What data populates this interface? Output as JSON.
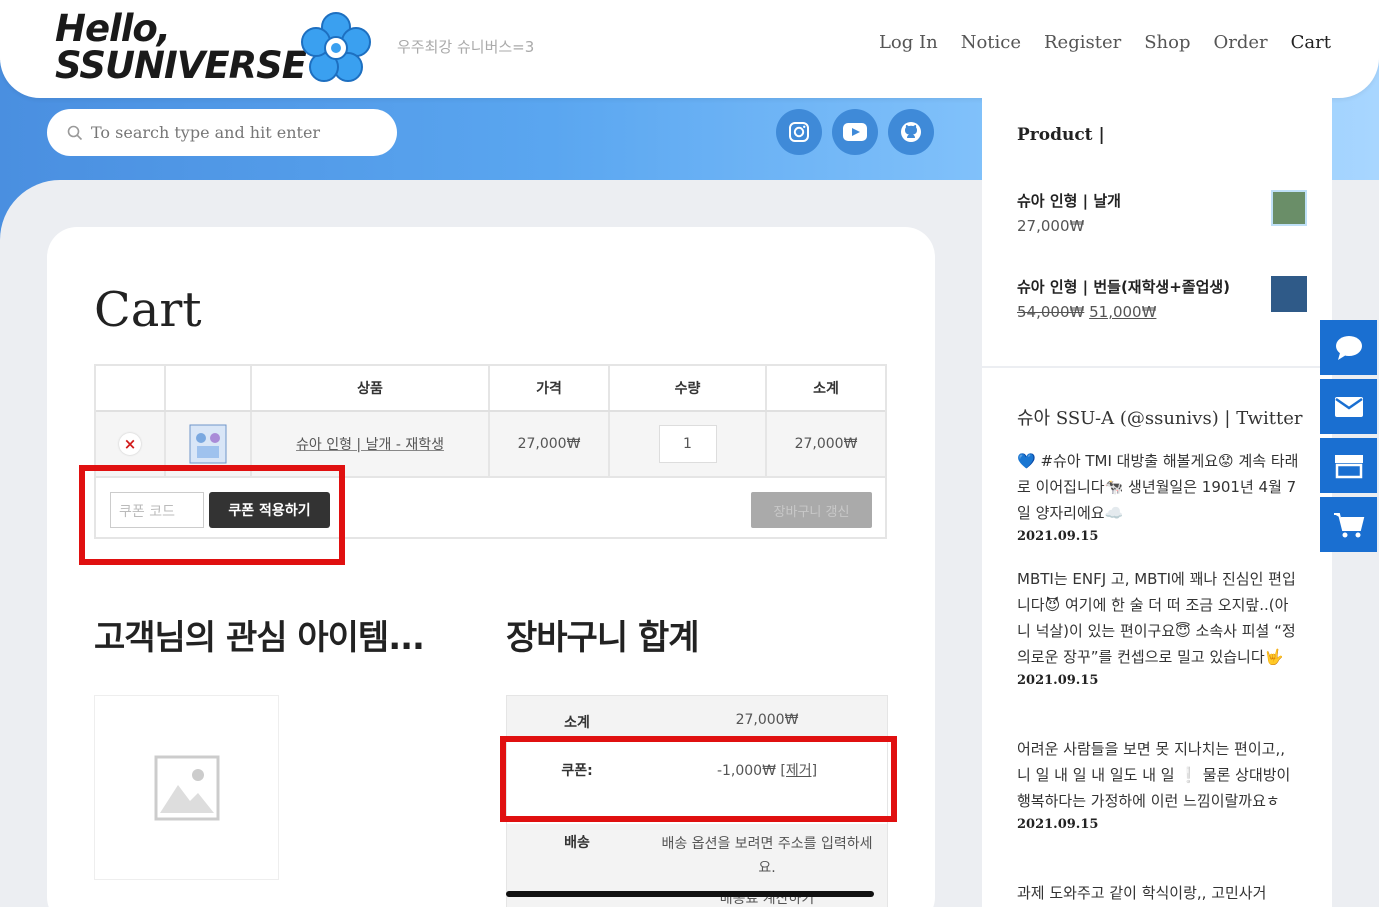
{
  "header": {
    "logo_line1": "Hello,",
    "logo_line2": "SSUNIVERSE",
    "tagline": "우주최강 슈니버스=3",
    "nav": [
      "Log In",
      "Notice",
      "Register",
      "Shop",
      "Order",
      "Cart"
    ]
  },
  "search": {
    "placeholder": "To search type and hit enter"
  },
  "socials": [
    "instagram-icon",
    "youtube-icon",
    "github-icon"
  ],
  "cart": {
    "title": "Cart",
    "columns": [
      "",
      "",
      "상품",
      "가격",
      "수량",
      "소계"
    ],
    "rows": [
      {
        "product": "슈아 인형 | 날개 - 재학생",
        "price": "27,000₩",
        "qty": "1",
        "subtotal": "27,000₩"
      }
    ],
    "coupon_placeholder": "쿠폰 코드",
    "coupon_button": "쿠폰 적용하기",
    "update_button": "장바구니 갱신"
  },
  "cross_sells": {
    "title": "고객님의 관심 아이템..."
  },
  "totals": {
    "title": "장바구니 합계",
    "subtotal_label": "소계",
    "subtotal": "27,000₩",
    "coupon_label": "쿠폰:",
    "coupon_value": "-1,000₩",
    "coupon_remove": "[제거]",
    "shipping_label": "배송",
    "shipping_text": "배송 옵션을 보려면 주소를 입력하세요.",
    "shipping_calc": "배송료 계산하기"
  },
  "sidebar": {
    "product_heading": "Product |",
    "products": [
      {
        "name": "슈아 인형 | 날개",
        "price": "27,000₩"
      },
      {
        "name": "슈아 인형 | 번들(재학생+졸업생)",
        "old_price": "54,000₩",
        "price": "51,000₩"
      }
    ],
    "twitter_title": "슈아 SSU-A (@ssunivs) | Twitter",
    "tweets": [
      {
        "text": "💙 #슈아 TMI 대방출 해볼게요😟 계속 타래로 이어집니다🐄 생년월일은 1901년 4월 7일 양자리에요☁️",
        "date": "2021.09.15"
      },
      {
        "text": "MBTI는 ENFJ 고, MBTI에 꽤나 진심인 편입니다😈 여기에 한 술 더 떠 조금 오지랖..(아니 넉살)이 있는 편이구요😇 소속사 피셜 “정의로운 장꾸”를 컨셉으로 밀고 있습니다🤟",
        "date": "2021.09.15"
      },
      {
        "text": "어려운 사람들을 보면 못 지나치는 편이고,, 니 일 내 일 내 일도 내 일 ❕ 물론 상대방이 행복하다는 가정하에 이런 느낌이랄까요ㅎ",
        "date": "2021.09.15"
      },
      {
        "text": "과제 도와주고 같이 학식이랑,, 고민사거",
        "date": ""
      }
    ]
  },
  "side_buttons": [
    "chat-icon",
    "mail-icon",
    "store-icon",
    "cart-icon"
  ]
}
